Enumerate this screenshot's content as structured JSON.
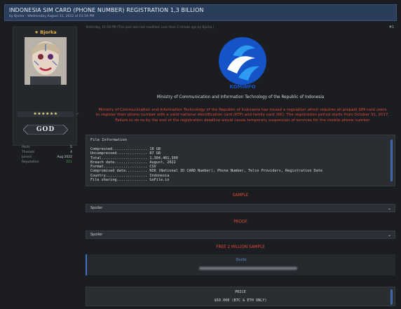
{
  "thread": {
    "title": "INDONESIA SIM CARD (PHONE NUMBER) REGISTRATION 1,3 BILLION",
    "byline": "by Bjorka - Wednesday August 31, 2022 at 01:59 PM"
  },
  "user": {
    "name": "Bjorka",
    "rating_stars": "★★★★★★",
    "rank": "GOD",
    "stats": [
      {
        "label": "Posts",
        "value": "5"
      },
      {
        "label": "Threads",
        "value": "4"
      },
      {
        "label": "Joined",
        "value": "Aug 2022"
      },
      {
        "label": "Reputation",
        "value": "211"
      }
    ]
  },
  "post": {
    "meta": "Yesterday, 01:59 PM  (This post was last modified: Less than 1 minute ago by Bjorka.)",
    "number": "#1",
    "logo_caption": "KOMINFO",
    "ministry": "Ministry of Communication and Information Technology of the Republic of Indonesia",
    "regulation": [
      "Ministry of Communication and Information Technology of the Republic of Indonesia has issued a regulation which requires all prepaid SIM card users",
      "to register their phone number with a valid national identification card (KTP) and family card (KK). The registration period starts from October 31, 2017.",
      "Failure to do so by the end of the registration deadline would cause temporary suspension of services for the mobile phone number"
    ],
    "file_info": {
      "title": "File Information",
      "lines": [
        "Compressed................ 18 GB",
        "Uncompressed.............. 87 GB",
        "Total..................... 1,304,401,300",
        "Breach date............... August, 2022",
        "Format.................... CSV",
        "Compromised data.......... NIK (National ID CARD Number), Phone Number, Telco Providers, Registration Date",
        "Country................... Indonesia",
        "File sharing.............. GoFile.io"
      ]
    },
    "sample_label": "SAMPLE",
    "spoiler_label": "Spoiler",
    "proof_label": "PROOF",
    "spoiler2_label": "Spoiler",
    "free_sample_label": "FREE 2 MILLION SAMPLE",
    "quote_label": "Quote",
    "price_title": "PRICE",
    "price_value": "$50.000 (BTC & ETH ONLY)"
  },
  "colors": {
    "header_bg": "#2a3d5a",
    "accent_red": "#e04a3b",
    "link_blue": "#5f8fd6"
  }
}
